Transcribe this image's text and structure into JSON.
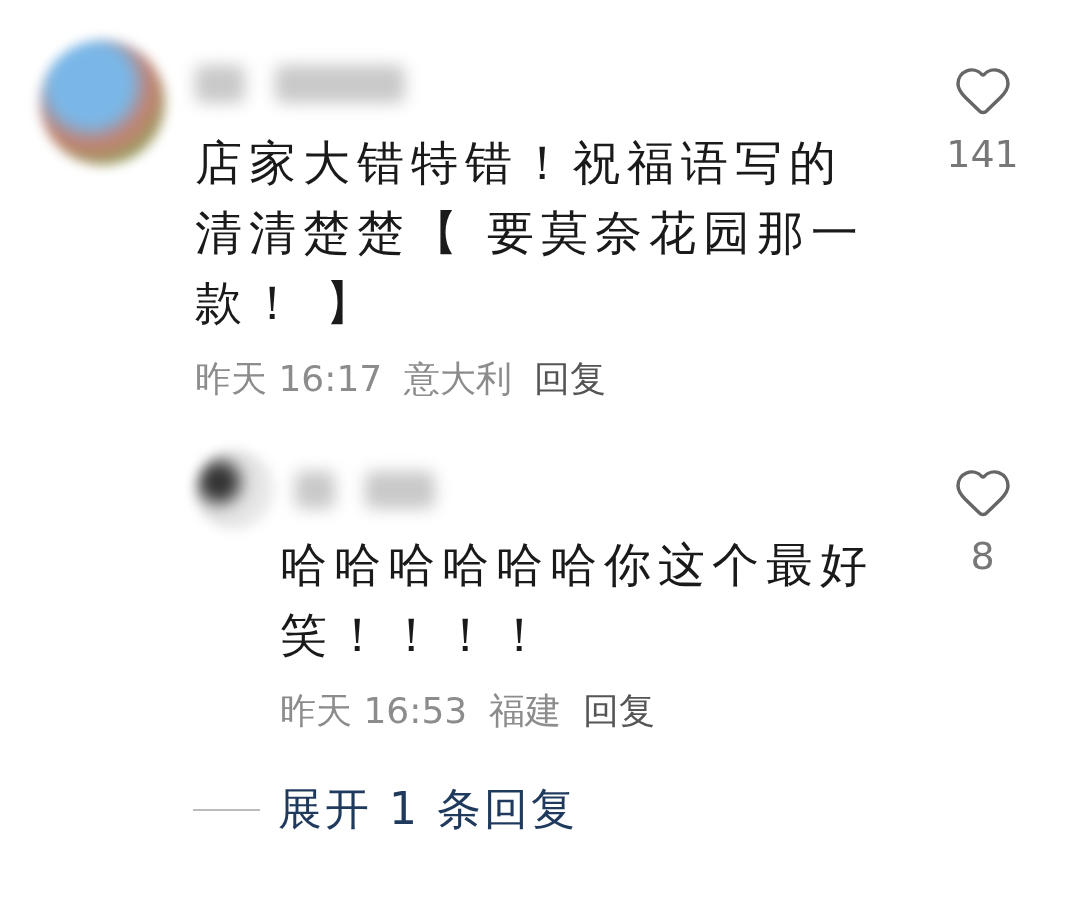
{
  "comments": [
    {
      "text": "店家大错特错！祝福语写的清清楚楚【 要莫奈花园那一款！ 】",
      "time": "昨天 16:17",
      "location": "意大利",
      "reply_label": "回复",
      "likes": "141",
      "liked": false,
      "replies": [
        {
          "text": "哈哈哈哈哈哈你这个最好笑！！！！",
          "time": "昨天 16:53",
          "location": "福建",
          "reply_label": "回复",
          "likes": "8",
          "liked": false
        }
      ]
    }
  ],
  "expand": {
    "label": "展开 1 条回复"
  }
}
